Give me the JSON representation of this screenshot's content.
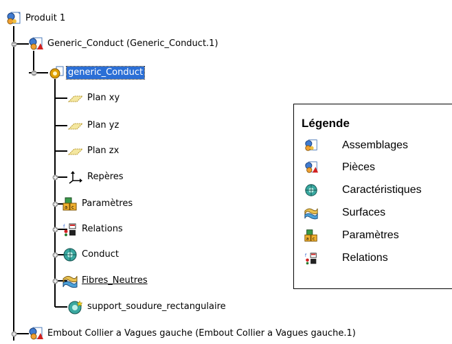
{
  "tree": {
    "root": {
      "label": "Produit 1",
      "icon": "assembly-icon"
    },
    "product": {
      "label": "Generic_Conduct (Generic_Conduct.1)",
      "icon": "part-icon"
    },
    "part": {
      "label": "generic_Conduct",
      "icon": "feature-icon"
    },
    "children": [
      {
        "label": "Plan xy",
        "icon": "plane-icon"
      },
      {
        "label": "Plan yz",
        "icon": "plane-icon"
      },
      {
        "label": "Plan zx",
        "icon": "plane-icon"
      },
      {
        "label": "Repères",
        "icon": "axis-system-icon"
      },
      {
        "label": "Paramètres",
        "icon": "parameters-icon"
      },
      {
        "label": "Relations",
        "icon": "relations-icon"
      },
      {
        "label": "Conduct",
        "icon": "feature-icon"
      },
      {
        "label": "Fibres_Neutres",
        "icon": "surfaces-icon"
      },
      {
        "label": "support_soudure_rectangulaire",
        "icon": "feature-icon"
      }
    ],
    "last": {
      "label": "Embout Collier a Vagues gauche (Embout Collier a Vagues gauche.1)",
      "icon": "part-icon"
    }
  },
  "legend": {
    "title": "Légende",
    "items": [
      {
        "label": "Assemblages",
        "icon": "assembly-icon"
      },
      {
        "label": "Pièces",
        "icon": "part-icon"
      },
      {
        "label": "Caractéristiques",
        "icon": "feature-icon"
      },
      {
        "label": "Surfaces",
        "icon": "surfaces-icon"
      },
      {
        "label": "Paramètres",
        "icon": "parameters-icon"
      },
      {
        "label": "Relations",
        "icon": "relations-icon"
      }
    ]
  },
  "colors": {
    "selection": "#2b6fd6",
    "tree_line": "#000000",
    "expander": "#7a7a7a"
  }
}
